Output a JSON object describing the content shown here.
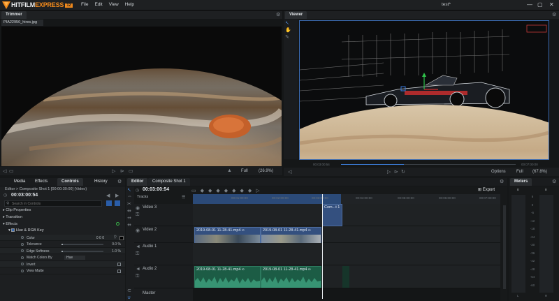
{
  "app": {
    "brand_main": "HITFILM",
    "brand_sub": "EXPRESS",
    "version": "12",
    "menu": [
      "File",
      "Edit",
      "View",
      "Help"
    ],
    "project_name": "test*",
    "window_controls": {
      "min": "—",
      "max": "▢",
      "close": "✕"
    }
  },
  "trimmer": {
    "tab": "Trimmer",
    "file": "PIA22950_hires.jpg",
    "zoom_mode": "Full",
    "zoom": "(26.9%)"
  },
  "viewer": {
    "tab": "Viewer",
    "timecode_left": "00:03:00:54",
    "timecode_right": "00:07:00:00",
    "options": "Options",
    "zoom_mode": "Full",
    "zoom": "(67.8%)",
    "progress": 0.36
  },
  "left_panel": {
    "tabs": [
      "Media",
      "Effects",
      "Controls",
      "History"
    ],
    "active_tab": "Controls",
    "breadcrumb": "Editor > Composite Shot 1 [00:00:30:00] (Video)",
    "timecode": "00:03:00:54",
    "search_placeholder": "Search in Controls",
    "sections": [
      "Clip Properties",
      "Transition",
      "Effects"
    ],
    "effect_name": "Hue & RGB Key",
    "params": [
      {
        "name": "Color",
        "value": "0   0   0",
        "fill": 0
      },
      {
        "name": "Tolerance",
        "value": "0.0 %",
        "fill": 0
      },
      {
        "name": "Edge Softness",
        "value": "1.0 %",
        "fill": 0.01
      },
      {
        "name": "Match Colors By",
        "value": "Hue",
        "fill": 0
      },
      {
        "name": "Invert",
        "value": "",
        "fill": 0
      },
      {
        "name": "View Matte",
        "value": "",
        "fill": 0
      }
    ]
  },
  "editor": {
    "tabs": [
      "Editor",
      "Composite Shot 1"
    ],
    "timecode": "00:03:00:54",
    "tracks_label": "Tracks",
    "export": "Export",
    "ruler": [
      "00:01:00:00",
      "00:02:00:00",
      "00:03:00:00",
      "00:04:00:00",
      "00:05:00:00",
      "00:06:00:00",
      "00:07:00:00"
    ],
    "tracks": [
      {
        "name": "Video 3",
        "kind": "video"
      },
      {
        "name": "Video 2",
        "kind": "video"
      },
      {
        "name": "Audio 1",
        "kind": "audio"
      },
      {
        "name": "Audio 2",
        "kind": "audio"
      },
      {
        "name": "Master",
        "kind": "master"
      }
    ],
    "clips": {
      "composite": "Com...t 1",
      "video_a": "2019-08-01 11-28-41.mp4 ∞",
      "video_b": "2019-08-01 11-28-41.mp4 ∞",
      "audio_a": "2019-08-01 11-28-41.mp4 ∞",
      "audio_b": "2019-08-01 11-28-41.mp4 ∞"
    }
  },
  "meters": {
    "tab": "Meters",
    "lr": [
      "0",
      "0"
    ],
    "scale": [
      "6",
      "0",
      "-6",
      "-12",
      "-18",
      "-24",
      "-30",
      "-36",
      "-42",
      "-48",
      "-54",
      "-60"
    ],
    "bottom": [
      "L",
      "R"
    ]
  },
  "colors": {
    "accent": "#f28a1c",
    "selection": "#264a7a",
    "video_clip": "#34507f",
    "audio_clip": "#1c5c45"
  },
  "icons": [
    "hitfilm-logo-icon",
    "gear-icon",
    "play-icon",
    "step-back-icon",
    "step-forward-icon",
    "eye-icon",
    "speaker-icon",
    "lock-icon",
    "search-icon",
    "checkbox-icon",
    "eyedropper-icon",
    "magnet-icon",
    "razor-icon",
    "select-tool-icon"
  ]
}
